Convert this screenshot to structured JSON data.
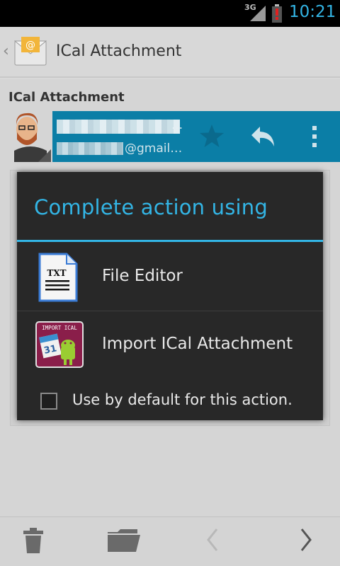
{
  "status_bar": {
    "network": "3G",
    "time": "10:21"
  },
  "app_bar": {
    "title": "ICal Attachment",
    "icon": "email-app-icon"
  },
  "message": {
    "subject": "ICal Attachment",
    "sender_email_suffix": "@gmail…"
  },
  "dialog": {
    "title": "Complete action using",
    "options": [
      {
        "label": "File Editor",
        "icon": "txt-file-icon",
        "icon_text": "TXT"
      },
      {
        "label": "Import ICal Attachment",
        "icon": "import-ical-icon",
        "icon_text": "IMPORT ICAL"
      }
    ],
    "default_checkbox": {
      "label": "Use by default for this action.",
      "checked": false
    }
  },
  "bottom_bar": {
    "items": [
      "trash-icon",
      "folder-icon",
      "prev-icon",
      "next-icon"
    ]
  },
  "colors": {
    "accent": "#33b5e5",
    "sender_bar": "#0b7ea6",
    "dialog_bg": "#282828"
  }
}
